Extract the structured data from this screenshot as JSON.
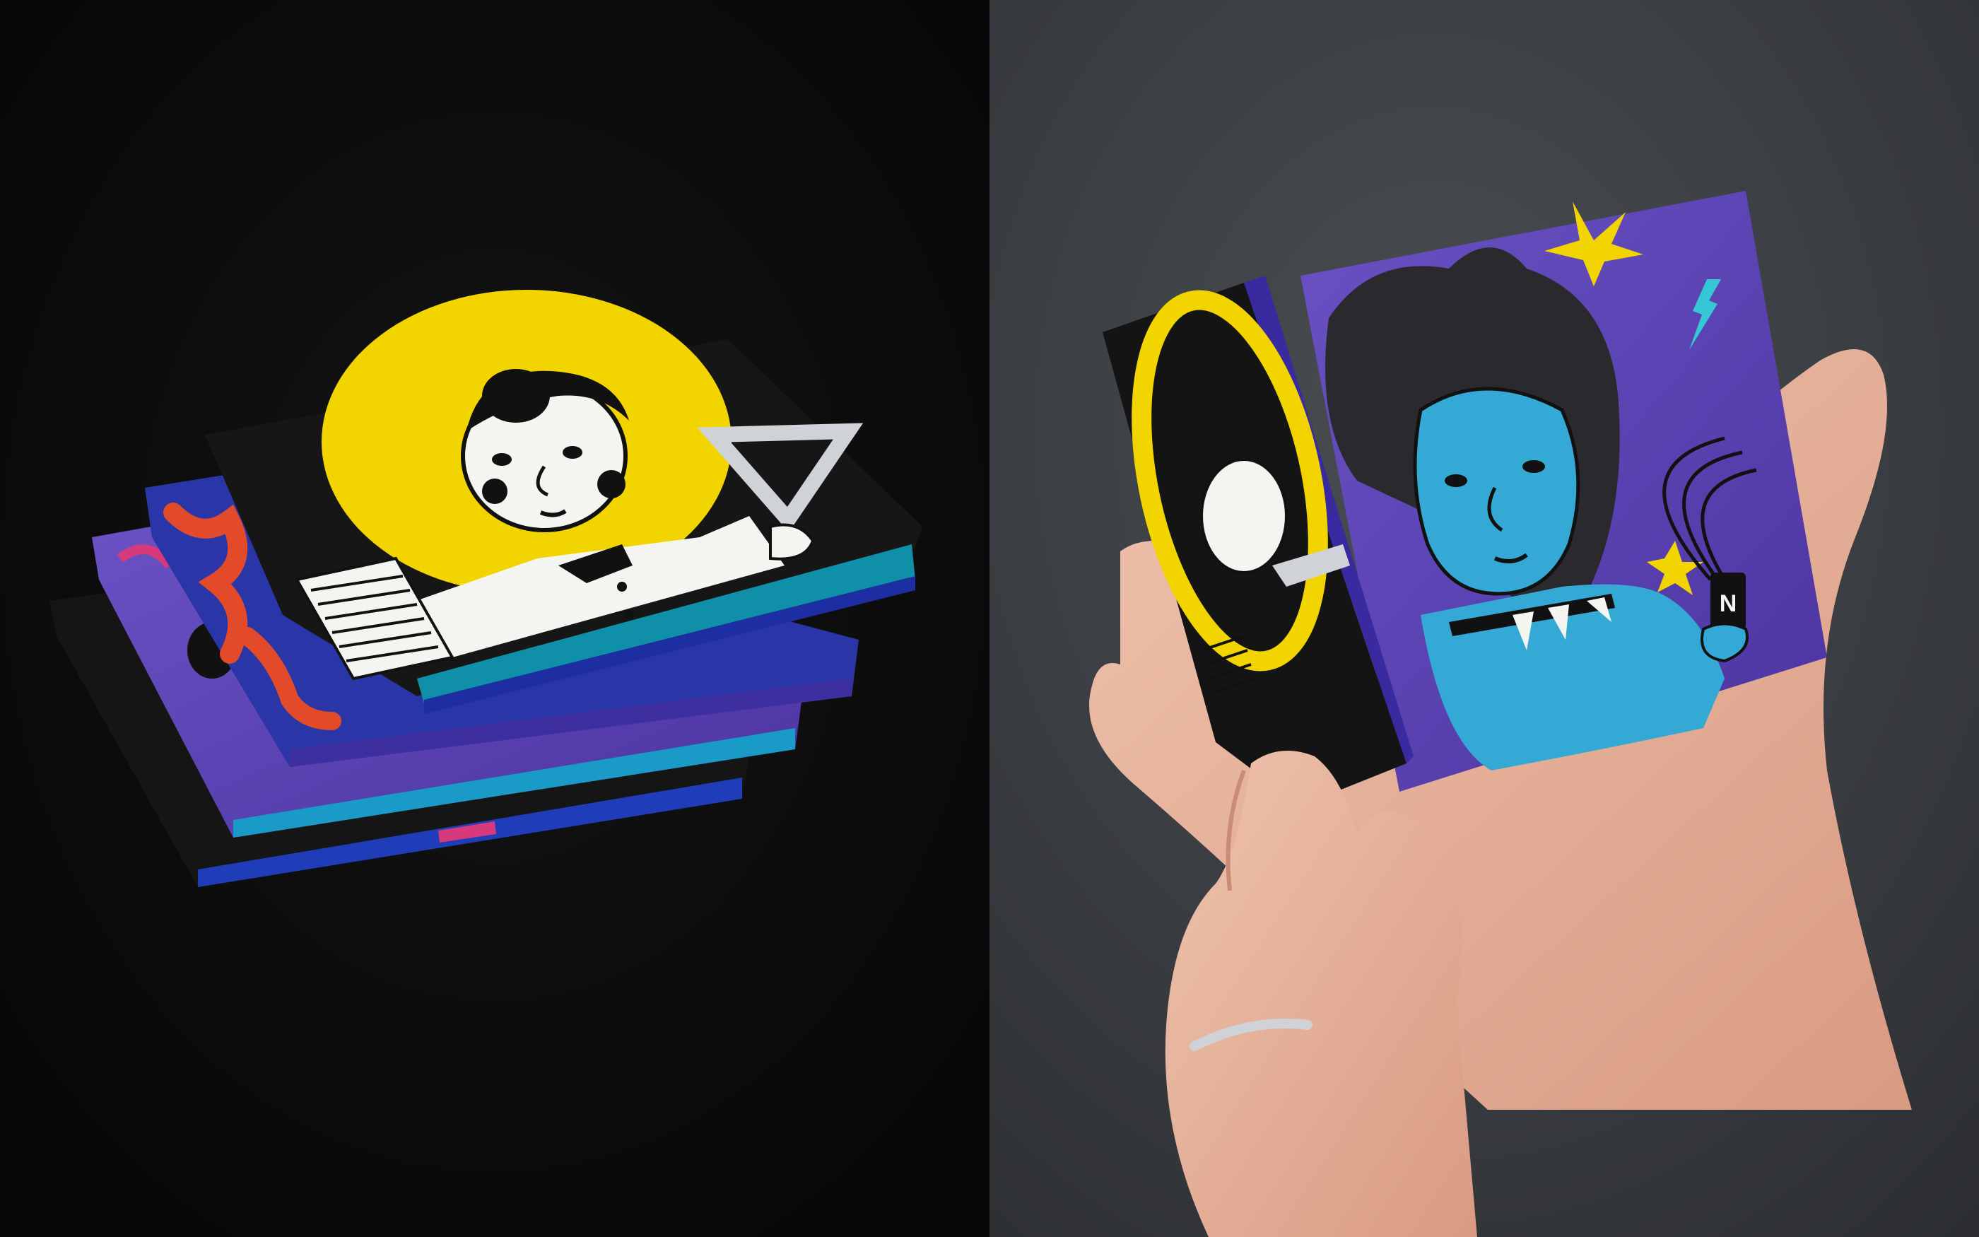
{
  "image": {
    "description_label": "",
    "panels": [
      {
        "id": "left",
        "subject": "stack-of-illustrated-folded-packages"
      },
      {
        "id": "right",
        "subject": "hands-opening-illustrated-package"
      }
    ],
    "colors": {
      "left_bg": "#0b0b0b",
      "right_bg": "#3a3d41",
      "yellow": "#f2d400",
      "black": "#111111",
      "white": "#f4f4f0",
      "royal_blue": "#2c3aa8",
      "purple": "#5a3fb0",
      "teal": "#1aa7c9",
      "cyan_face": "#35a9d6",
      "orange_red": "#e34a2a",
      "pink": "#d63a7a",
      "skin": "#e8b6a0",
      "skin_shadow": "#c98c74",
      "silver": "#cfd2d6"
    }
  }
}
